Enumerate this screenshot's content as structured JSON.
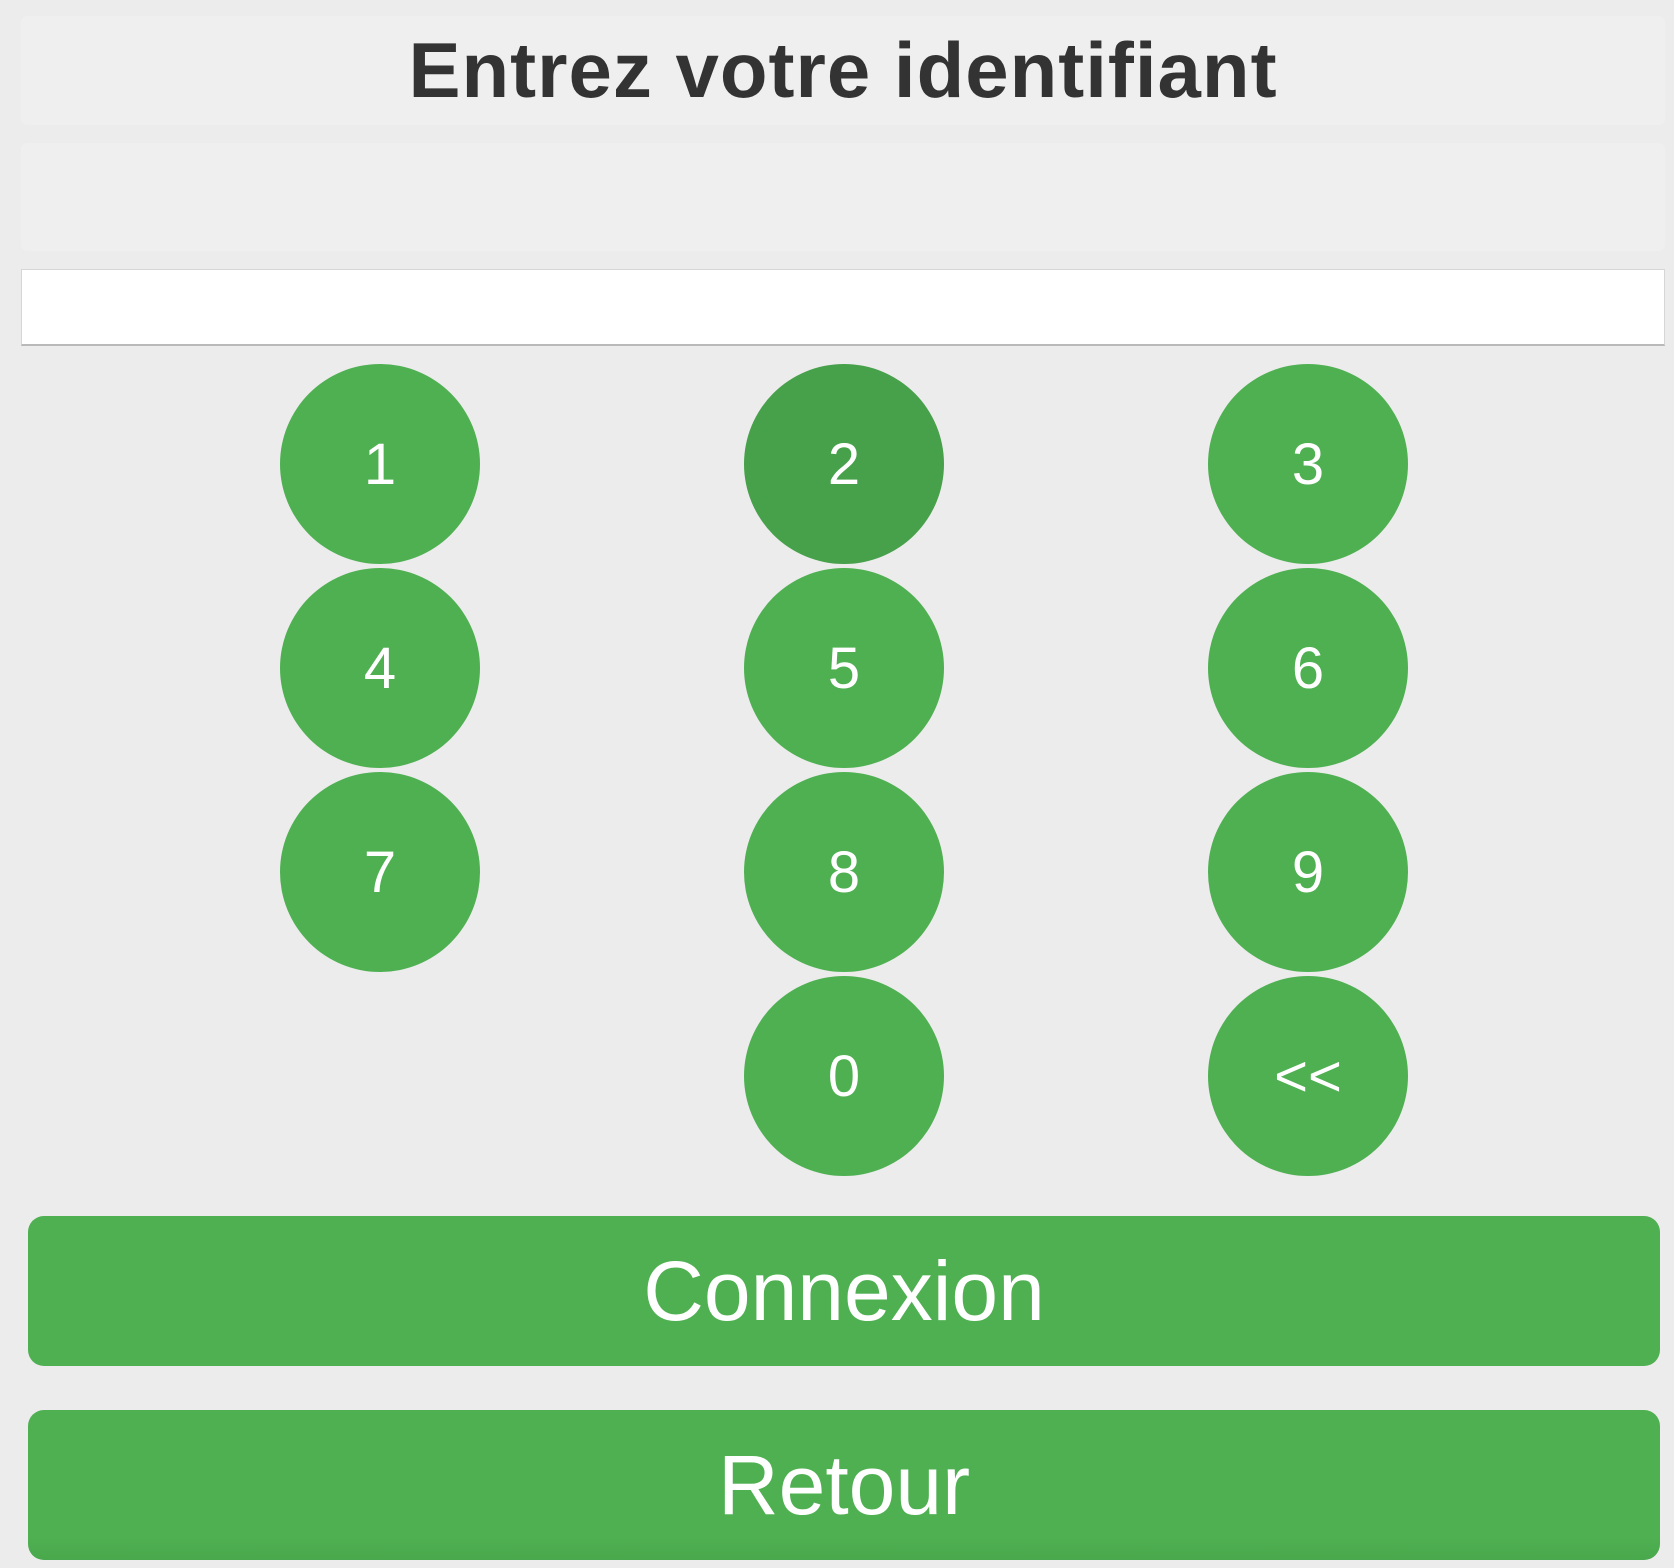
{
  "header": {
    "title": "Entrez votre identifiant"
  },
  "message": {
    "text": ""
  },
  "identifier_input": {
    "value": "",
    "placeholder": ""
  },
  "keypad": {
    "keys": [
      {
        "label": "1"
      },
      {
        "label": "2"
      },
      {
        "label": "3"
      },
      {
        "label": "4"
      },
      {
        "label": "5"
      },
      {
        "label": "6"
      },
      {
        "label": "7"
      },
      {
        "label": "8"
      },
      {
        "label": "9"
      },
      {
        "label": "0"
      },
      {
        "label": "<<"
      }
    ]
  },
  "actions": {
    "connexion_label": "Connexion",
    "retour_label": "Retour"
  },
  "colors": {
    "button_green": "#4fb052",
    "button_green_pressed": "#47a04a",
    "background": "#ececec",
    "title_text": "#333333"
  }
}
